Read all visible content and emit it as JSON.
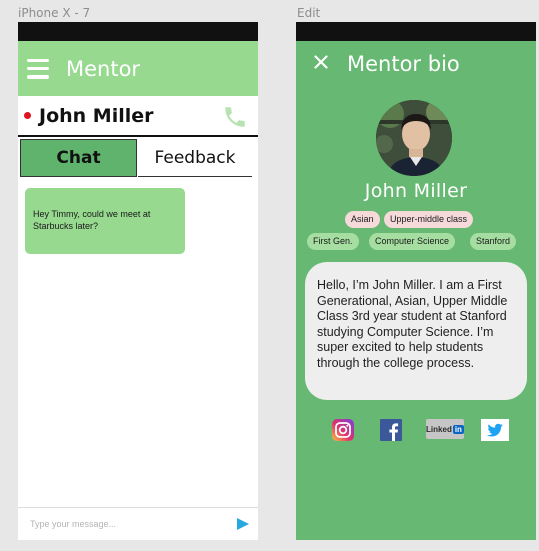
{
  "artboards": {
    "chat_label": "iPhone X - 7",
    "bio_label": "Edit"
  },
  "chat": {
    "header_title": "Mentor",
    "contact_name": "John Miller",
    "tabs": [
      {
        "label": "Chat",
        "active": true
      },
      {
        "label": "Feedback",
        "active": false
      }
    ],
    "message": "Hey Timmy, could we meet at Starbucks later?",
    "composer_placeholder": "Type your message..."
  },
  "bio": {
    "title": "Mentor bio",
    "name": "John Miller",
    "tags": [
      "Asian",
      "Upper-middle class",
      "First Gen.",
      "Computer Science",
      "Stanford"
    ],
    "bio_text": "Hello, I’m John Miller. I am a First Generational, Asian, Upper Middle Class 3rd year student at Stanford studying Computer Science. I’m super excited to help students through the college process.",
    "social": {
      "linkedin_text": "Linked",
      "linkedin_in": "in"
    }
  },
  "colors": {
    "header_green": "#96d98f",
    "tab_green": "#5fb36c",
    "bio_background": "#66b872",
    "status_dot": "#e0141e",
    "send_blue": "#29a8e0"
  },
  "icons": [
    "hamburger-icon",
    "phone-icon",
    "send-icon",
    "close-icon",
    "instagram-icon",
    "facebook-icon",
    "linkedin-icon",
    "twitter-icon"
  ]
}
